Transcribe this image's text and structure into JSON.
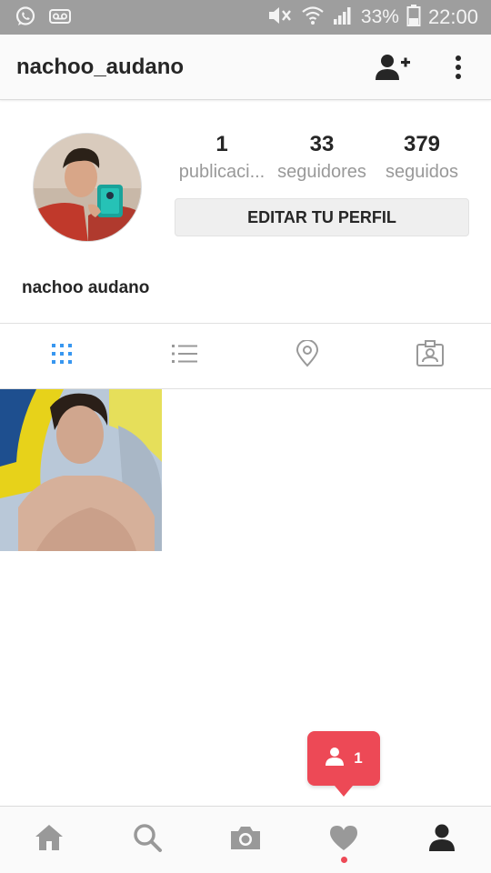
{
  "status_bar": {
    "battery": "33%",
    "time": "22:00",
    "icons": [
      "whatsapp-icon",
      "voicemail-icon",
      "mute-icon",
      "wifi-icon",
      "signal-icon",
      "battery-icon"
    ]
  },
  "header": {
    "username": "nachoo_audano",
    "icons": [
      "add-user-icon",
      "more-vertical-icon"
    ]
  },
  "profile": {
    "full_name": "nachoo audano",
    "stats": [
      {
        "value": "1",
        "label": "publicaci..."
      },
      {
        "value": "33",
        "label": "seguidores"
      },
      {
        "value": "379",
        "label": "seguidos"
      }
    ],
    "edit_button": "EDITAR TU PERFIL"
  },
  "tabs": [
    {
      "icon": "grid-icon",
      "active": true
    },
    {
      "icon": "list-icon",
      "active": false
    },
    {
      "icon": "location-pin-icon",
      "active": false
    },
    {
      "icon": "tagged-photos-icon",
      "active": false
    }
  ],
  "posts": [
    {
      "type": "photo"
    }
  ],
  "activity_popover": {
    "count": "1",
    "icon": "person-icon"
  },
  "bottom_nav": [
    {
      "icon": "home-icon"
    },
    {
      "icon": "search-icon"
    },
    {
      "icon": "camera-icon"
    },
    {
      "icon": "heart-icon",
      "notification_dot": true
    },
    {
      "icon": "profile-icon",
      "active": true
    }
  ],
  "colors": {
    "status_bar": "#9e9e9e",
    "accent_blue": "#3897f0",
    "notification_red": "#ed4956",
    "inactive_icon": "#999999",
    "text_primary": "#262626"
  }
}
